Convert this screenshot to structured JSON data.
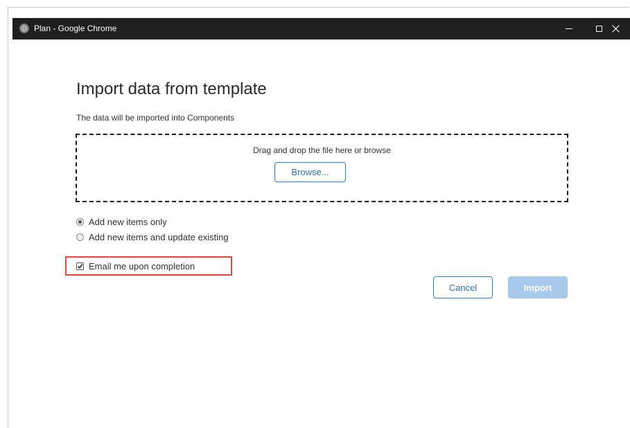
{
  "window": {
    "title": "Plan - Google Chrome",
    "app_icon": "chrome-globe-icon",
    "controls": {
      "minimize_icon": "minimize-icon",
      "maximize_icon": "maximize-icon",
      "close_icon": "close-icon"
    }
  },
  "dialog": {
    "title": "Import data from template",
    "subtitle": "The data will be imported into Components",
    "dropzone": {
      "text": "Drag and drop the file here or browse",
      "browse_label": "Browse..."
    },
    "options": [
      {
        "label": "Add new items only",
        "selected": true
      },
      {
        "label": "Add new items and update existing",
        "selected": false
      }
    ],
    "email_checkbox": {
      "label": "Email me upon completion",
      "checked": true
    },
    "buttons": {
      "cancel_label": "Cancel",
      "import_label": "Import"
    }
  },
  "colors": {
    "titlebar": "#1f1f1f",
    "accent": "#2f7fd1",
    "import_disabled": "#a7c9ec",
    "highlight": "#e04848"
  }
}
